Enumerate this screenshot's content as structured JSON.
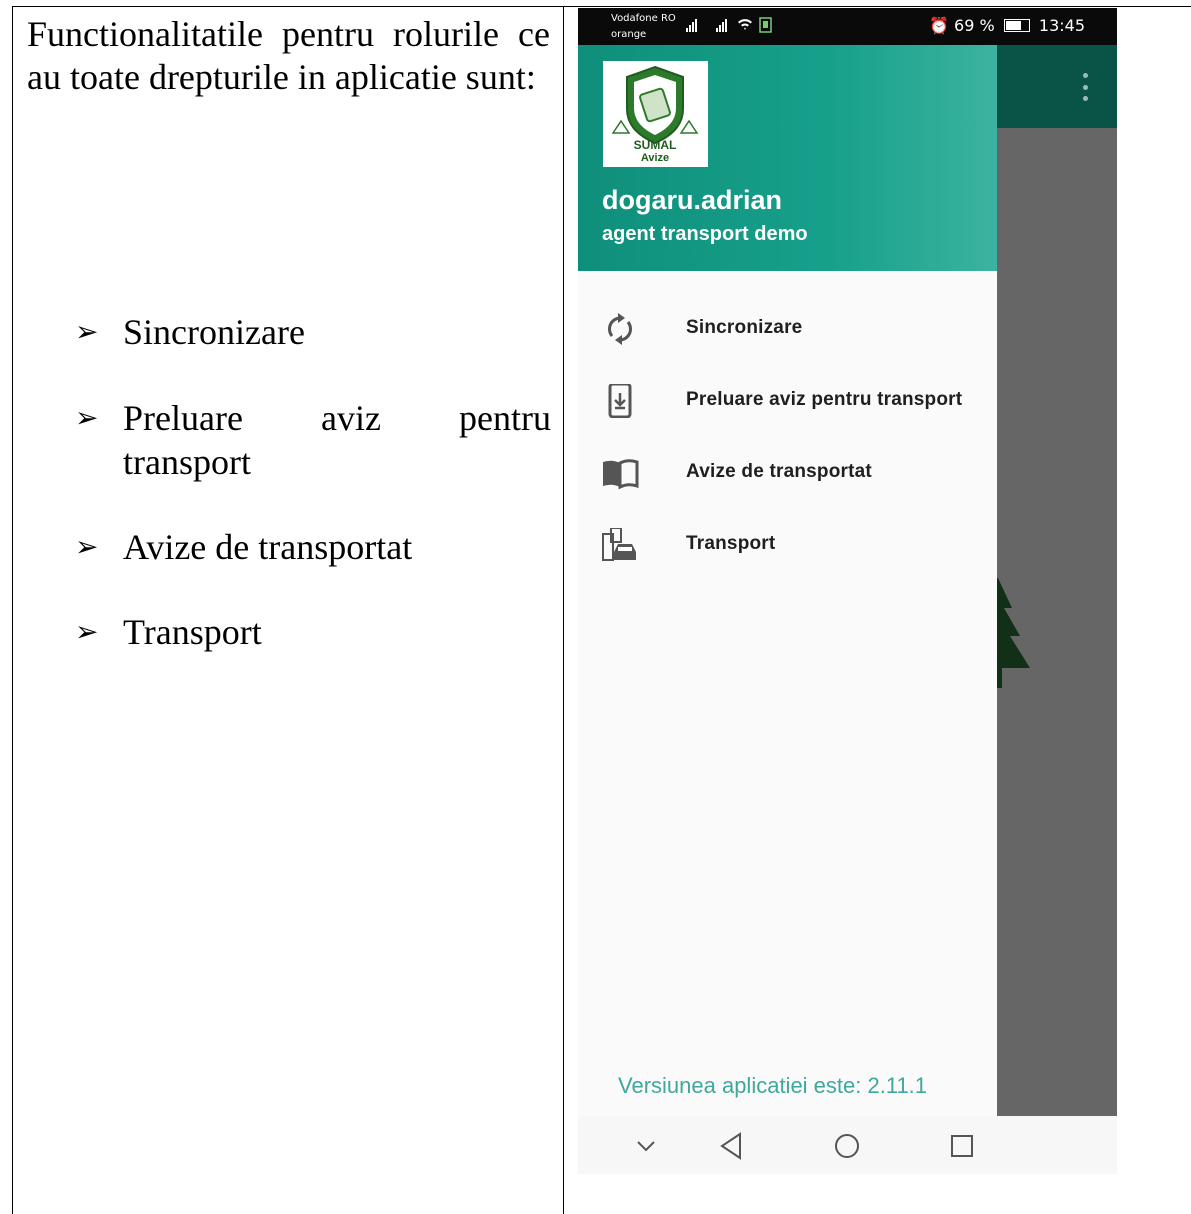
{
  "document": {
    "intro": "Functionalitatile pentru rolurile ce au toate drepturile in aplicatie sunt:",
    "bullets": [
      {
        "line1_words": [
          "Preluare",
          "aviz",
          "pentru"
        ],
        "line2": "transport"
      }
    ],
    "bullet_simple": [
      "Sincronizare",
      "Avize de transportat",
      "Transport"
    ],
    "arrow_glyph": "➢"
  },
  "phone": {
    "status": {
      "carrier_line1": "Vodafone RO",
      "carrier_line2": "orange",
      "battery": "69 %",
      "time": "13:45"
    },
    "drawer": {
      "logo_line1": "SUMAL",
      "logo_line2": "Avize",
      "user_name": "dogaru.adrian",
      "user_role": "agent transport demo",
      "items": [
        {
          "label": "Sincronizare",
          "icon": "sync-icon"
        },
        {
          "label": "Preluare aviz pentru transport",
          "icon": "phone-download-icon"
        },
        {
          "label": "Avize de transportat",
          "icon": "open-book-icon"
        },
        {
          "label": "Transport",
          "icon": "building-car-icon"
        }
      ],
      "version": "Versiunea aplicatiei este: 2.11.1"
    },
    "colors": {
      "header_start": "#0f8f7b",
      "appbar": "#0a5347",
      "version_text": "#3fa89c",
      "overlay": "#666666"
    }
  }
}
